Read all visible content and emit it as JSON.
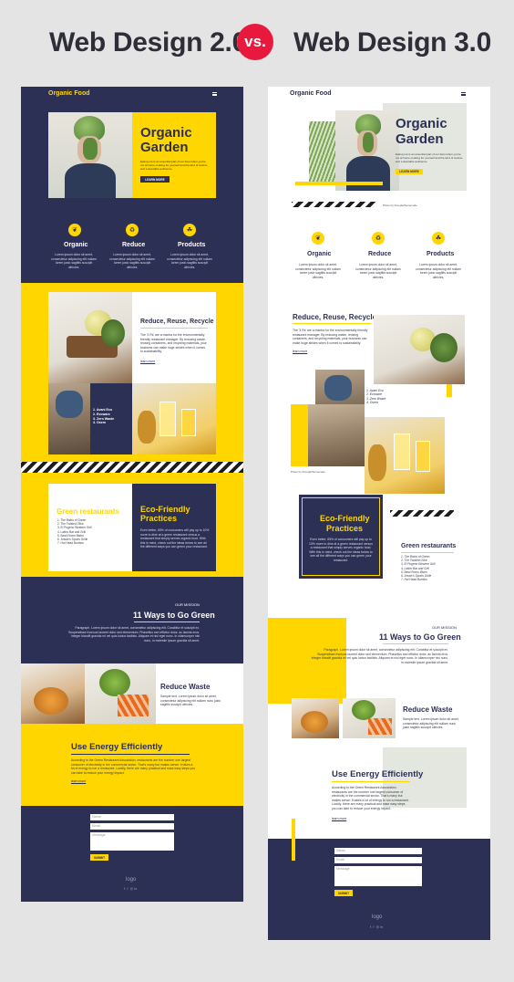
{
  "heading": {
    "left": "Web Design 2.0",
    "vs": "vs.",
    "right": "Web Design 3.0"
  },
  "colors": {
    "navy": "#2c3054",
    "yellow": "#ffd600",
    "accent": "#e8193c"
  },
  "left": {
    "logo": "Organic Food",
    "menu_icon": "hamburger-icon",
    "hero_title_1": "Organic",
    "hero_title_2": "Garden",
    "hero_text": "Eating out is an essential part of our lives when you're not at home cooking for yourself and the kind of cuisine and a desirable ambience.",
    "hero_button": "LEARN MORE",
    "features": [
      {
        "icon": "leaf-icon",
        "title": "Organic",
        "text": "Lorem ipsum dolor sit amet, consectetur adipiscing elit nullam lorem justo sagittis suscipit ultricies."
      },
      {
        "icon": "recycle-icon",
        "title": "Reduce",
        "text": "Lorem ipsum dolor sit amet, consectetur adipiscing elit nullam lorem justo sagittis suscipit ultricies."
      },
      {
        "icon": "basket-icon",
        "title": "Products",
        "text": "Lorem ipsum dolor sit amet, consectetur adipiscing elit nullam lorem justo sagittis suscipit ultricies."
      }
    ],
    "reduce_title": "Reduce, Reuse, Recycle",
    "reduce_text": "The '3 Rs' are a mantra for the environmentally friendly restaurant manager. By reducing waste, reusing containers, and recycling materials, your business can make huge strides when it comes to sustainability.",
    "reduce_link": "learn more",
    "list": [
      "1. Avani Eco",
      "2. Evoware",
      "3. Zero Waste",
      "4. Osem"
    ],
    "green_title": "Green restaurants",
    "green_list": [
      "1. The Bistro of Green",
      "2. The Twisted Olive",
      "3. El Pugeno Western Grill",
      "4. Latino Bar and Grill",
      "5. Basil Room Bistro",
      "6. Jessie's Sports Grille",
      "7. Hot Head Burritos"
    ],
    "eco_title_1": "Eco-Friendly",
    "eco_title_2": "Practices",
    "eco_text": "Even better, 65% of consumers will pay up to 10% more to dine at a green restaurant versus a restaurant that simply serves organic food. With this in mind, check out the ideas below to see all the different ways you can green your restaurant.",
    "mission_label": "OUR MISSION",
    "mission_title": "11 Ways to Go Green",
    "mission_text": "Paragraph. Lorem ipsum dolor sit amet, consectetur adipiscing elit. Curabitur et suscipit ex. Suspendisse rhoncus laoreet dolor sed elementum. Phasellus sed efficitur dolor, ac lacinia eros. Integer blandit gravida mi vel quis luctus facilisis. Aliquam et nisl eget nunc. In ullamcorper nisi nunc, in molestie ipsum gravida sit amet.",
    "waste_title": "Reduce Waste",
    "waste_text": "Sample text. Lorem ipsum dolor sit amet, consectetur adipiscing elit nullam nunc justo sagittis suscipit ultricies.",
    "energy_title": "Use Energy Efficiently",
    "energy_text": "According to the Green Restaurant Association, restaurants are the number one largest consumer of electricity in the commercial sector. That's many but makes sense: it takes a lot of energy to run a restaurant. Luckily, there are many practical and ease easy steps you can take to reduce your energy impact.",
    "energy_link": "learn more",
    "form_name": "Name",
    "form_email": "Email",
    "form_message": "Message",
    "form_submit": "SUBMIT",
    "footer_logo": "logo",
    "social": "f  ✓  ◎  in"
  },
  "right": {
    "logo": "Organic Food",
    "menu_icon": "hamburger-icon",
    "hero_title_1": "Organic",
    "hero_title_2": "Garden",
    "hero_text": "Eating out is an essential part of our lives when you're not at home cooking for yourself and the kind of cuisine and a desirable ambience.",
    "hero_button": "LEARN MORE",
    "photo_credit": "Photo by Freepik/Somecode",
    "features": [
      {
        "icon": "leaf-icon",
        "title": "Organic",
        "text": "Lorem ipsum dolor sit amet, consectetur adipiscing elit nullam lorem justo sagittis suscipit ultricies."
      },
      {
        "icon": "recycle-icon",
        "title": "Reduce",
        "text": "Lorem ipsum dolor sit amet, consectetur adipiscing elit nullam lorem justo sagittis suscipit ultricies."
      },
      {
        "icon": "basket-icon",
        "title": "Products",
        "text": "Lorem ipsum dolor sit amet, consectetur adipiscing elit nullam lorem justo sagittis suscipit ultricies."
      }
    ],
    "reduce_title": "Reduce, Reuse, Recycle",
    "reduce_text": "The '3 Rs' are a mantra for the environmentally friendly restaurant manager. By reducing waste, reusing containers, and recycling materials, your business can make huge strides when it comes to sustainability.",
    "reduce_link": "learn more",
    "list": [
      "1. Avani Eco",
      "2. Evoware",
      "3. Zero Waste",
      "4. Osem"
    ],
    "photo_credit2": "Photo by Freepik/Somecode",
    "eco_title_1": "Eco-Friendly",
    "eco_title_2": "Practices",
    "eco_text": "Even better, 65% of consumers will pay up to 10% more to dine at a green restaurant versus a restaurant that simply serves organic food. With this in mind, check out the ideas below to see all the different ways you can green your restaurant.",
    "green_title": "Green restaurants",
    "green_list": [
      "1. The Bistro of Green",
      "2. The Twisted Olive",
      "3. El Pugeno Western Grill",
      "4. Latino Bar and Grill",
      "5. Basil Room Bistro",
      "6. Jessie's Sports Grille",
      "7. Hot Head Burritos"
    ],
    "mission_label": "OUR MISSION",
    "mission_title": "11 Ways to Go Green",
    "mission_text": "Paragraph. Lorem ipsum dolor sit amet, consectetur adipiscing elit. Curabitur et suscipit ex. Suspendisse rhoncus laoreet dolor sed elementum. Phasellus sed efficitur dolor, ac lacinia eros. Integer blandit gravida mi vel quis luctus facilisis. Aliquam et nisl eget nunc. In ullamcorper nisi nunc, in molestie ipsum gravida sit amet.",
    "waste_title": "Reduce Waste",
    "waste_text": "Sample text. Lorem ipsum dolor sit amet, consectetur adipiscing elit nullam nunc justo sagittis suscipit ultricies.",
    "energy_title": "Use Energy Efficiently",
    "energy_text": "According to the Green Restaurant Association, restaurants are the number one largest consumer of electricity in the commercial sector. That's many but makes sense: it takes a lot of energy to run a restaurant. Luckily, there are many practical and ease easy steps you can take to reduce your energy impact.",
    "energy_link": "learn more",
    "form_name": "Name",
    "form_email": "Email",
    "form_message": "Message",
    "form_submit": "SUBMIT",
    "footer_logo": "logo",
    "social": "f  ✓  ◎  in"
  }
}
